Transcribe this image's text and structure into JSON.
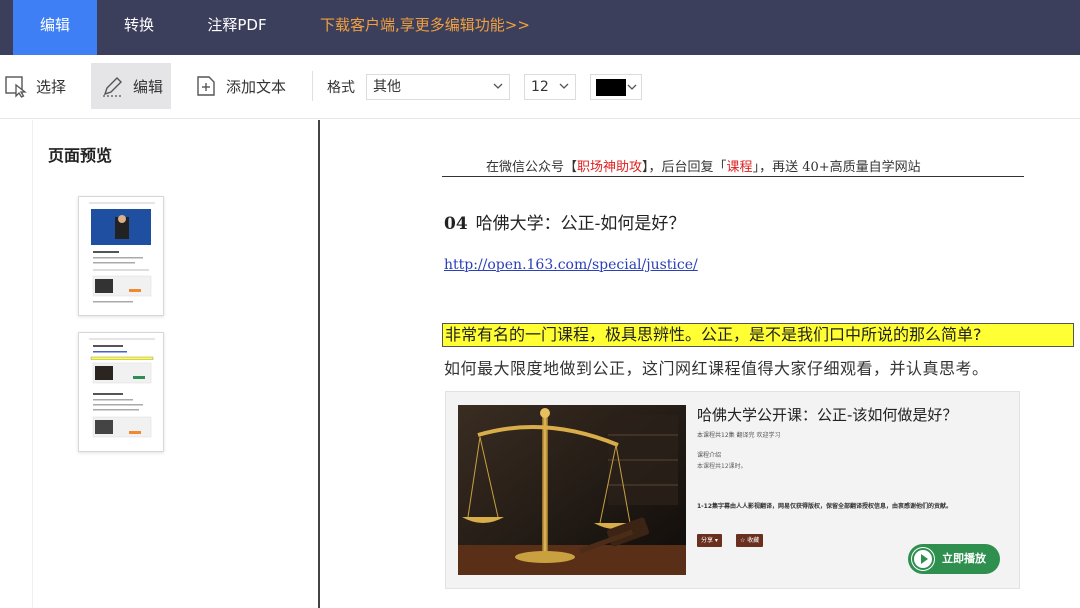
{
  "topbar": {
    "tabs": [
      {
        "label": "编辑",
        "active": true
      },
      {
        "label": "转换",
        "active": false
      },
      {
        "label": "注释PDF",
        "active": false
      }
    ],
    "promo": "下载客户端,享更多编辑功能>>"
  },
  "toolbar": {
    "select_label": "选择",
    "edit_label": "编辑",
    "add_text_label": "添加文本",
    "format_label": "格式",
    "format_value": "其他",
    "font_size_value": "12",
    "text_color": "#000000"
  },
  "sidebar": {
    "title": "页面预览",
    "pages": [
      1,
      2
    ]
  },
  "document": {
    "header_pre": "在微信公众号【",
    "header_red1": "职场神助攻",
    "header_mid": "】，后台回复「",
    "header_red2": "课程",
    "header_post": "」，再送 40+高质量自学网站",
    "heading_num": "04",
    "heading_text": "哈佛大学：公正-如何是好？",
    "link": "http://open.163.com/special/justice/",
    "highlight_text": "非常有名的一门课程，极具思辨性。公正，是不是我们口中所说的那么简单?",
    "paragraph": "如何最大限度地做到公正，这门网红课程值得大家仔细观看，并认真思考。",
    "card": {
      "title": "哈佛大学公开课：公正-该如何做是好？",
      "meta": "本课程共12集 翻译完 欢迎学习",
      "section": "课程介绍",
      "desc": "本课程共12课时。",
      "desc_bold": "1-12集字幕由人人影视翻译，网易仅获得版权，保留全部翻译授权信息，由衷感谢他们的贡献。",
      "share_label": "分享 ▾",
      "fav_label": "☆ 收藏",
      "play_label": "立即播放"
    }
  },
  "colors": {
    "topbar_bg": "#3c3f5c",
    "tab_active": "#3f7ff5",
    "promo": "#f0a040",
    "highlight": "#ffff33",
    "header_red": "#e02020",
    "play_green": "#2e8f4f"
  }
}
